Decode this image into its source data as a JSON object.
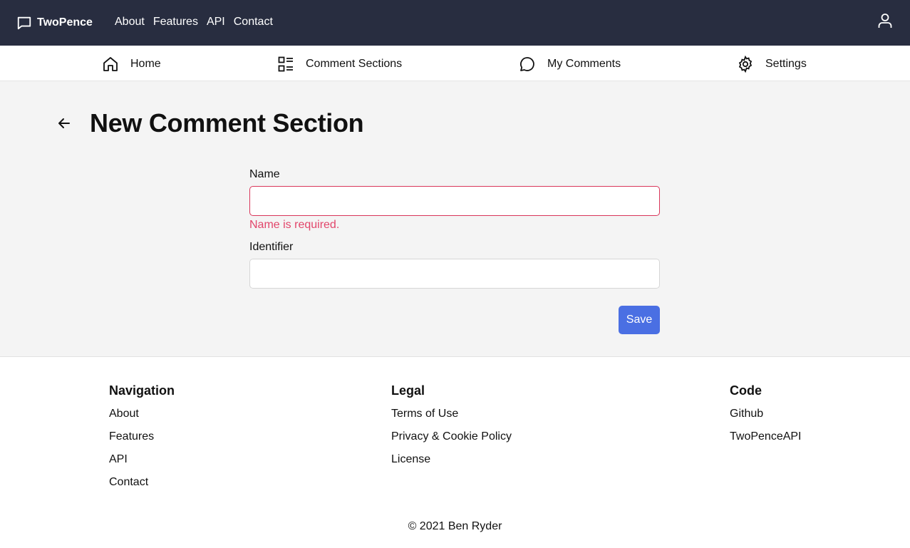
{
  "header": {
    "brand": "TwoPence",
    "nav": [
      "About",
      "Features",
      "API",
      "Contact"
    ]
  },
  "subnav": {
    "home": "Home",
    "comment_sections": "Comment Sections",
    "my_comments": "My Comments",
    "settings": "Settings"
  },
  "page": {
    "title": "New Comment Section"
  },
  "form": {
    "name_label": "Name",
    "name_value": "",
    "name_error": "Name is required.",
    "identifier_label": "Identifier",
    "identifier_value": "",
    "save_label": "Save"
  },
  "footer": {
    "navigation": {
      "heading": "Navigation",
      "links": [
        "About",
        "Features",
        "API",
        "Contact"
      ]
    },
    "legal": {
      "heading": "Legal",
      "links": [
        "Terms of Use",
        "Privacy & Cookie Policy",
        "License"
      ]
    },
    "code": {
      "heading": "Code",
      "links": [
        "Github",
        "TwoPenceAPI"
      ]
    },
    "copyright": "© 2021 Ben Ryder"
  },
  "colors": {
    "topbar_bg": "#282d40",
    "error": "#e2466b",
    "primary_button": "#4a6fe3",
    "main_bg": "#f4f4f4"
  },
  "icons": {
    "brand": "chat-bubble-icon",
    "user": "user-icon",
    "home": "home-icon",
    "comment_sections": "list-grid-icon",
    "my_comments": "comment-icon",
    "settings": "gear-icon",
    "back": "arrow-left-icon"
  }
}
